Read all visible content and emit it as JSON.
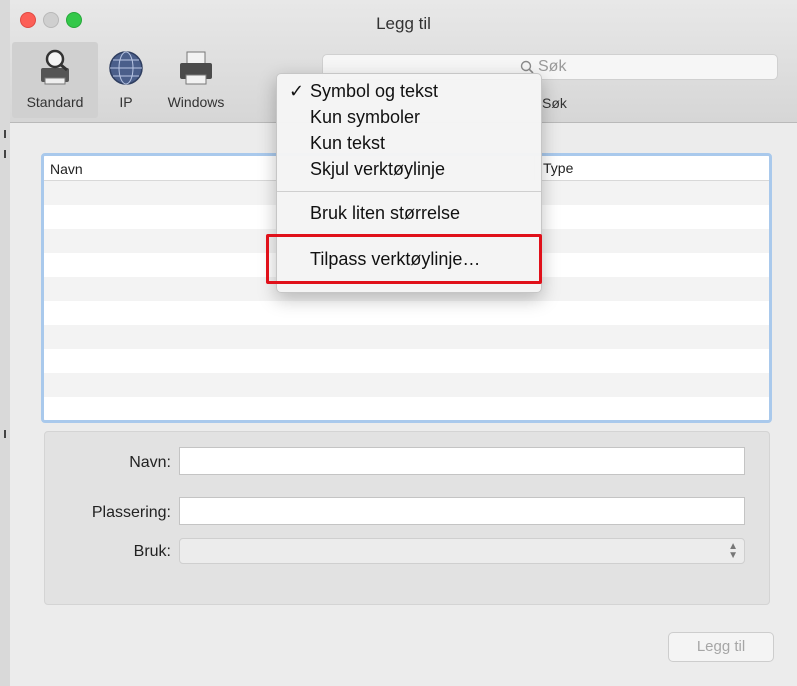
{
  "window": {
    "title": "Legg til"
  },
  "toolbar": {
    "items": [
      {
        "label": "Standard",
        "icon": "standard-printer-icon",
        "selected": true
      },
      {
        "label": "IP",
        "icon": "globe-icon",
        "selected": false
      },
      {
        "label": "Windows",
        "icon": "printer-icon",
        "selected": false
      }
    ],
    "search": {
      "placeholder": "Søk",
      "label": "Søk",
      "icon": "search-icon"
    }
  },
  "context_menu": {
    "items": [
      {
        "label": "Symbol og tekst",
        "checked": true,
        "check_glyph": "✓"
      },
      {
        "label": "Kun symboler",
        "checked": false
      },
      {
        "label": "Kun tekst",
        "checked": false
      },
      {
        "label": "Skjul verktøylinje",
        "checked": false
      },
      {
        "label": "Bruk liten størrelse",
        "checked": false
      },
      {
        "label": "Tilpass verktøylinje…",
        "checked": false
      }
    ],
    "highlight_color": "#e0101a"
  },
  "table": {
    "columns": [
      {
        "label": "Navn"
      },
      {
        "label": "Type"
      }
    ],
    "rows": []
  },
  "form": {
    "name": {
      "label": "Navn:",
      "value": ""
    },
    "location": {
      "label": "Plassering:",
      "value": ""
    },
    "use": {
      "label": "Bruk:",
      "value": ""
    }
  },
  "buttons": {
    "add_label": "Legg til"
  },
  "colors": {
    "close": "#fc5f57",
    "minimize": "#cfcfcf",
    "zoom": "#34c84a",
    "table_focus_ring": "#a9c9ec"
  }
}
